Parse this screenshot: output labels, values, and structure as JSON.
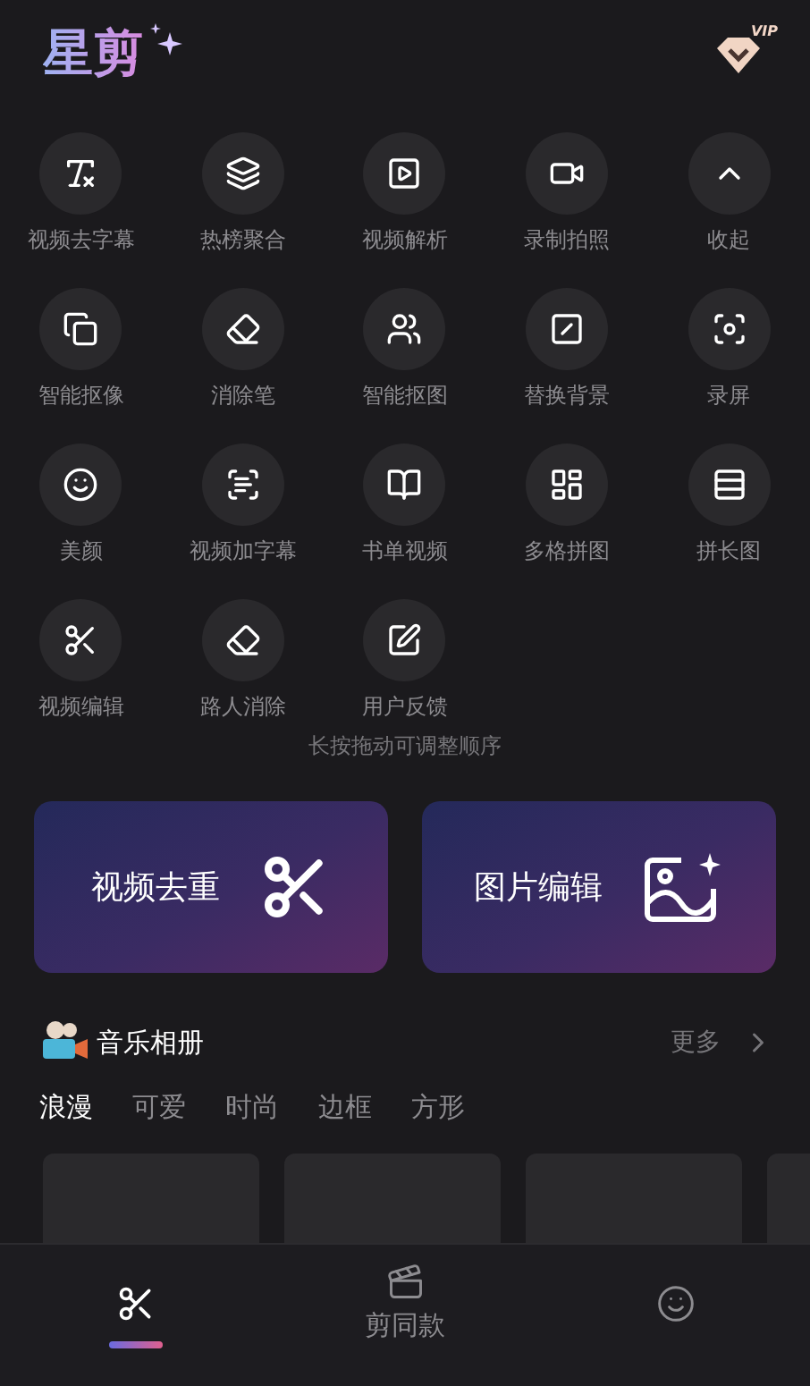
{
  "app": {
    "logo": "星剪",
    "vip_badge": "VIP"
  },
  "tools": [
    {
      "label": "视频去字幕"
    },
    {
      "label": "热榜聚合"
    },
    {
      "label": "视频解析"
    },
    {
      "label": "录制拍照"
    },
    {
      "label": "收起"
    },
    {
      "label": "智能抠像"
    },
    {
      "label": "消除笔"
    },
    {
      "label": "智能抠图"
    },
    {
      "label": "替换背景"
    },
    {
      "label": "录屏"
    },
    {
      "label": "美颜"
    },
    {
      "label": "视频加字幕"
    },
    {
      "label": "书单视频"
    },
    {
      "label": "多格拼图"
    },
    {
      "label": "拼长图"
    },
    {
      "label": "视频编辑"
    },
    {
      "label": "路人消除"
    },
    {
      "label": "用户反馈"
    }
  ],
  "hint": "长按拖动可调整顺序",
  "feature_cards": [
    {
      "label": "视频去重"
    },
    {
      "label": "图片编辑"
    }
  ],
  "music_album": {
    "title": "音乐相册",
    "more": "更多",
    "tabs": [
      {
        "label": "浪漫",
        "selected": true
      },
      {
        "label": "可爱",
        "selected": false
      },
      {
        "label": "时尚",
        "selected": false
      },
      {
        "label": "边框",
        "selected": false
      },
      {
        "label": "方形",
        "selected": false
      }
    ]
  },
  "bottom_nav": [
    {
      "selected": true
    },
    {
      "label": "剪同款",
      "selected": false
    },
    {
      "selected": false
    }
  ]
}
